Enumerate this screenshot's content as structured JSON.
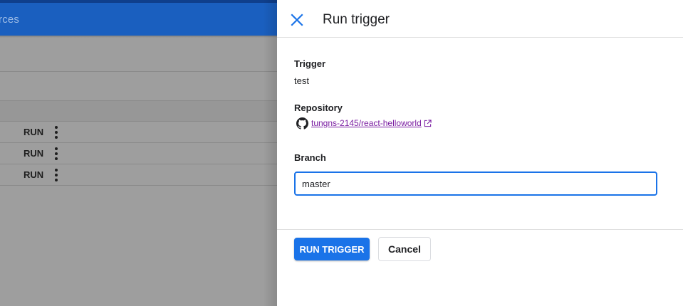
{
  "background": {
    "header_text": "rces",
    "rows": [
      {
        "action_label": "RUN"
      },
      {
        "action_label": "RUN"
      },
      {
        "action_label": "RUN"
      }
    ]
  },
  "panel": {
    "title": "Run trigger",
    "close_icon": "close-icon",
    "trigger": {
      "label": "Trigger",
      "value": "test"
    },
    "repository": {
      "label": "Repository",
      "value": "tungns-2145/react-helloworld",
      "icon": "github-icon"
    },
    "branch": {
      "label": "Branch",
      "value": "master"
    },
    "buttons": {
      "run": "RUN TRIGGER",
      "cancel": "Cancel"
    }
  },
  "colors": {
    "accent": "#1a73e8",
    "header_blue": "#1a5fbf",
    "link_purple": "#7b1fa2",
    "overlay_gray": "#9e9e9e"
  }
}
